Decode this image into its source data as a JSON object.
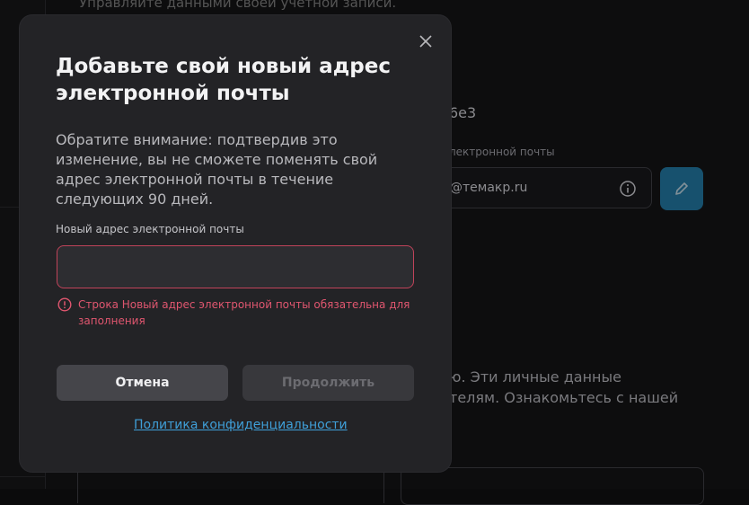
{
  "background": {
    "subtitle": "Управляйте данными своей учетной записи.",
    "account_id_fragment": "6e3",
    "email_label_fragment": "лектронной почты",
    "email_value_fragment": "@темакр.ru",
    "privacy_text_line1": "ю. Эти личные данные",
    "privacy_text_line2": "телям. Ознакомьтесь с нашей"
  },
  "modal": {
    "title": "Добавьте свой новый адрес электронной почты",
    "description": "Обратите внимание: подтвердив это изменение, вы не сможете поменять свой адрес электронной почты в течение следующих 90 дней.",
    "field_label": "Новый адрес электронной почты",
    "field_value": "",
    "error_message": "Строка Новый адрес электронной почты обязательна для заполнения",
    "cancel_label": "Отмена",
    "continue_label": "Продолжить",
    "privacy_link": "Политика конфиденциальности"
  },
  "colors": {
    "error": "#e0566f",
    "link": "#3f9fd8",
    "accent": "#1f7fae"
  }
}
